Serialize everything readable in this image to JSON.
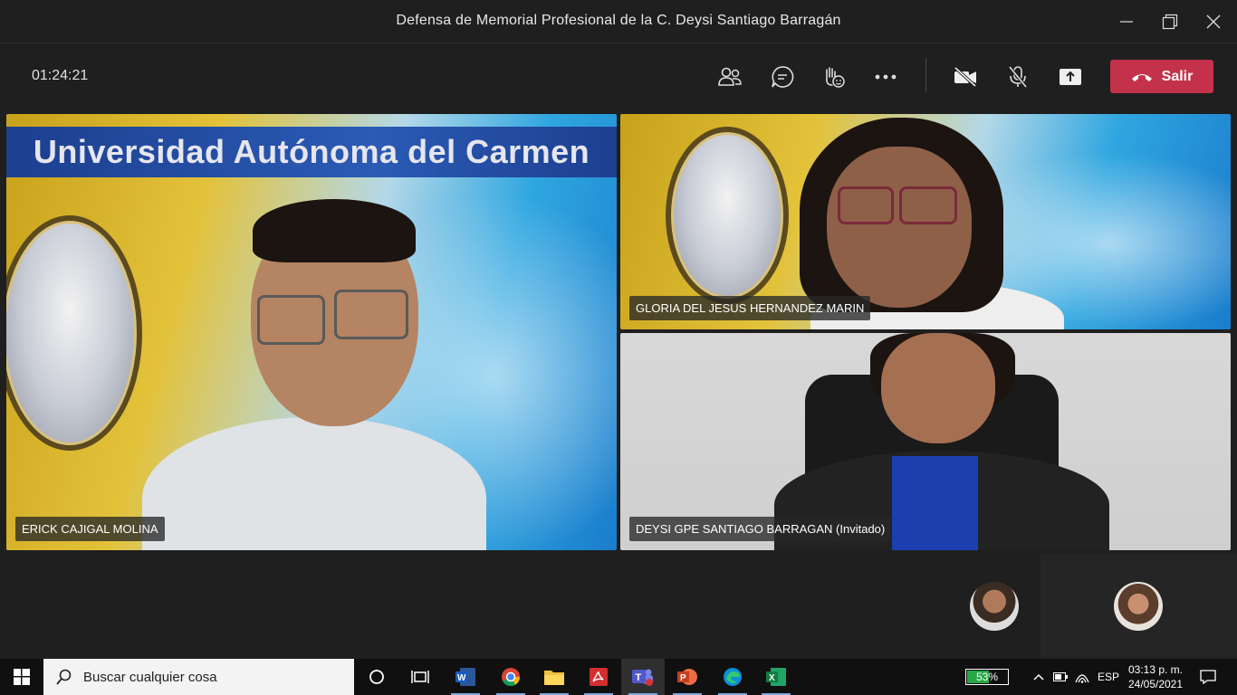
{
  "window": {
    "title": "Defensa de Memorial Profesional de la C. Deysi Santiago Barragán"
  },
  "meeting": {
    "elapsed": "01:24:21",
    "leave_label": "Salir",
    "colors": {
      "leave": "#c4314b",
      "background": "#1f1f1f"
    }
  },
  "participants": [
    {
      "name": "ERICK CAJIGAL MOLINA",
      "background_banner": "Universidad Autónoma del Carmen"
    },
    {
      "name": "GLORIA DEL JESUS HERNANDEZ MARIN"
    },
    {
      "name": "DEYSI GPE SANTIAGO BARRAGAN (Invitado)"
    }
  ],
  "taskbar": {
    "search_placeholder": "Buscar cualquier cosa",
    "battery_percent": "53%",
    "language": "ESP",
    "time": "03:13 p. m.",
    "date": "24/05/2021"
  }
}
